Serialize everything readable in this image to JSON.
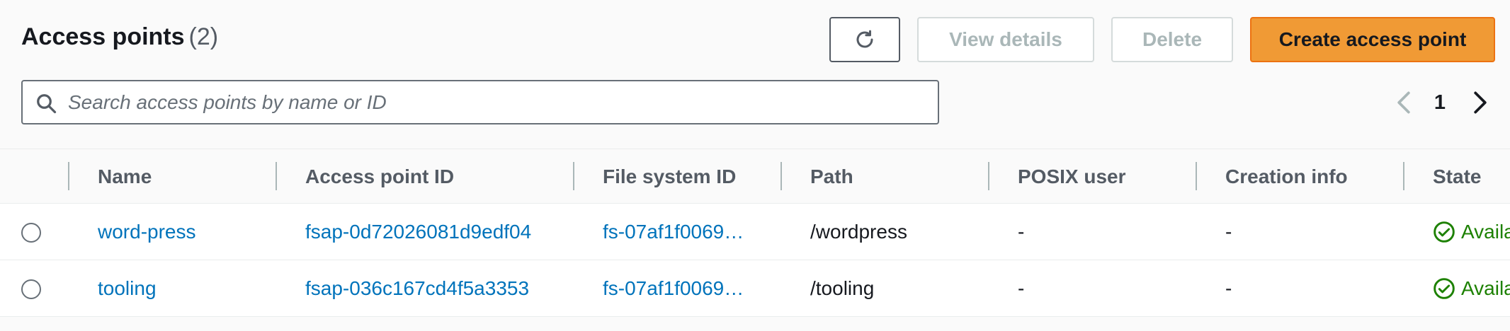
{
  "header": {
    "title": "Access points",
    "count": "(2)"
  },
  "toolbar": {
    "refresh_icon": "refresh-icon",
    "view_details_label": "View details",
    "delete_label": "Delete",
    "create_label": "Create access point"
  },
  "search": {
    "placeholder": "Search access points by name or ID",
    "value": ""
  },
  "pagination": {
    "current_page": "1"
  },
  "table": {
    "columns": [
      "Name",
      "Access point ID",
      "File system ID",
      "Path",
      "POSIX user",
      "Creation info",
      "State"
    ],
    "rows": [
      {
        "name": "word-press",
        "access_point_id": "fsap-0d72026081d9edf04",
        "file_system_id": "fs-07af1f0069…",
        "path": "/wordpress",
        "posix_user": "-",
        "creation_info": "-",
        "state": "Availa"
      },
      {
        "name": "tooling",
        "access_point_id": "fsap-036c167cd4f5a3353",
        "file_system_id": "fs-07af1f0069…",
        "path": "/tooling",
        "posix_user": "-",
        "creation_info": "-",
        "state": "Availa"
      }
    ]
  },
  "colors": {
    "primary_button": "#f09a35",
    "link": "#0073bb",
    "success": "#1d8102"
  }
}
